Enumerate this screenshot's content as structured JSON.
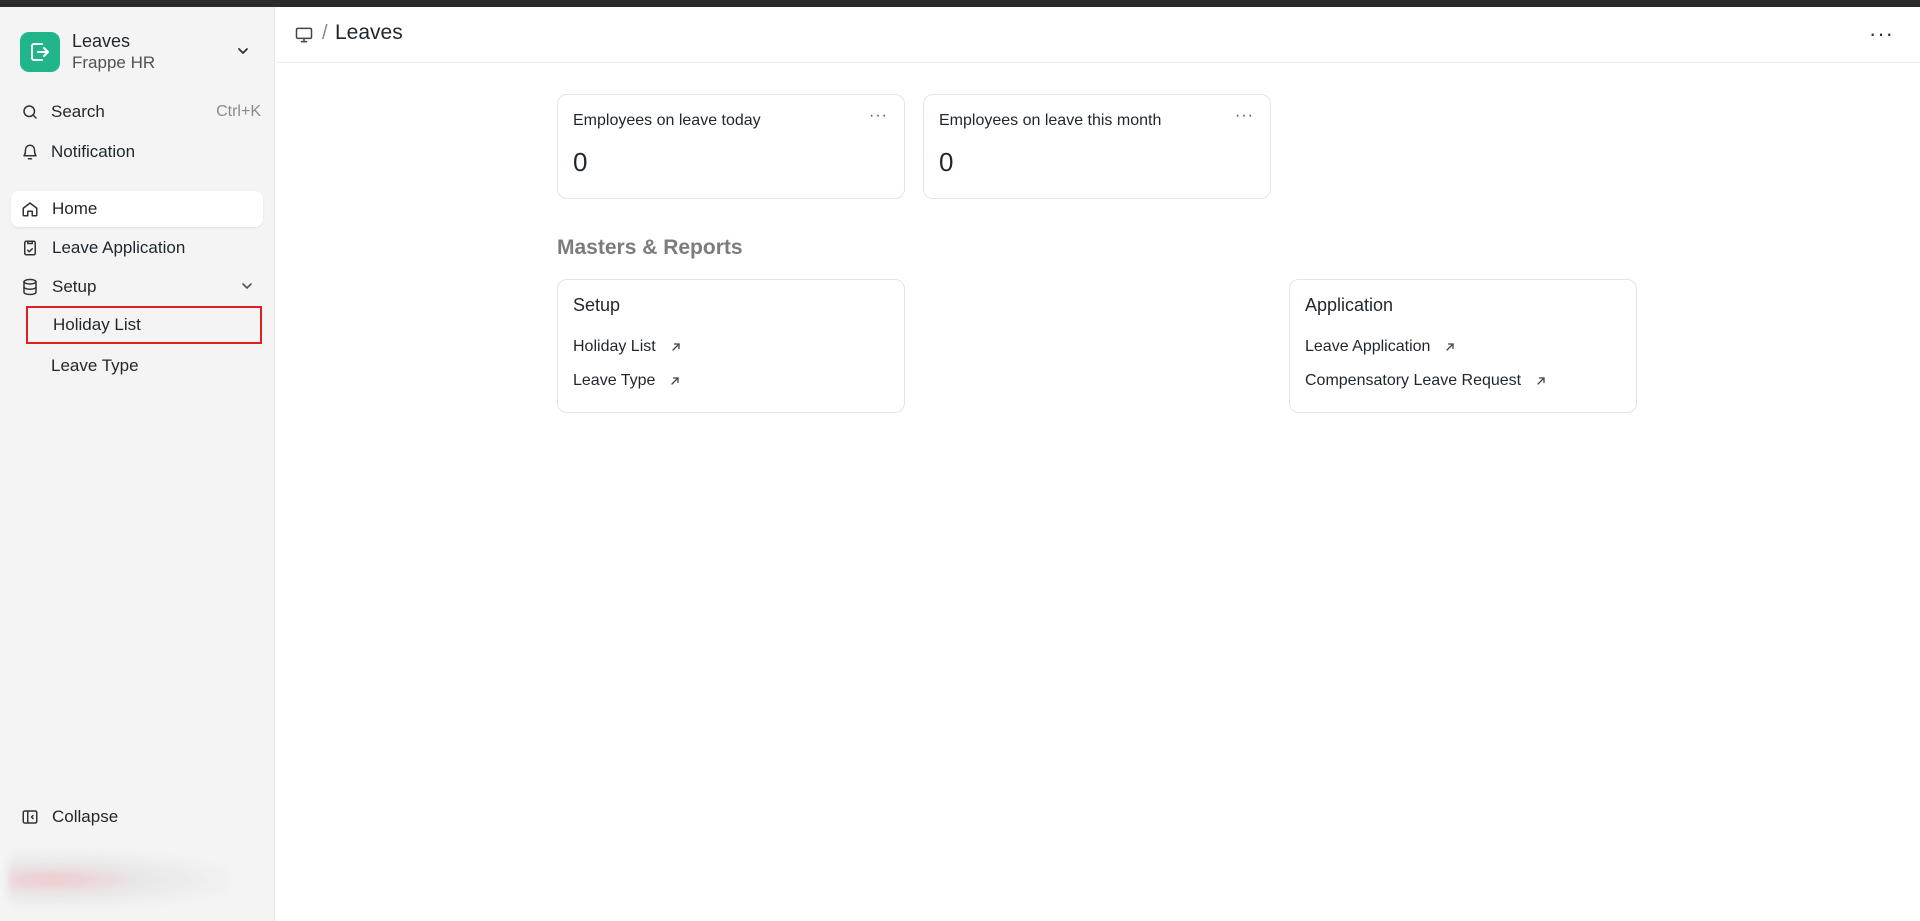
{
  "app": {
    "title": "Leaves",
    "subtitle": "Frappe HR"
  },
  "sidebar": {
    "search": {
      "label": "Search",
      "shortcut": "Ctrl+K"
    },
    "notification": {
      "label": "Notification"
    },
    "items": [
      {
        "label": "Home"
      },
      {
        "label": "Leave Application"
      },
      {
        "label": "Setup"
      }
    ],
    "setup_children": [
      {
        "label": "Holiday List"
      },
      {
        "label": "Leave Type"
      }
    ],
    "collapse": {
      "label": "Collapse"
    }
  },
  "header": {
    "breadcrumb_sep": "/",
    "title": "Leaves",
    "more": "···"
  },
  "number_cards": [
    {
      "title": "Employees on leave today",
      "value": "0",
      "menu": "···"
    },
    {
      "title": "Employees on leave this month",
      "value": "0",
      "menu": "···"
    }
  ],
  "section": {
    "title": "Masters & Reports"
  },
  "link_cards": [
    {
      "title": "Setup",
      "links": [
        {
          "label": "Holiday List"
        },
        {
          "label": "Leave Type"
        }
      ]
    },
    {
      "title": "Application",
      "links": [
        {
          "label": "Leave Application"
        },
        {
          "label": "Compensatory Leave Request"
        }
      ]
    }
  ],
  "colors": {
    "brand": "#21b68a",
    "highlight": "#e02020"
  },
  "icons": {
    "app_logo": "exit-icon",
    "search": "search-icon",
    "notification": "bell-icon",
    "home": "home-icon",
    "leave_application": "clipboard-icon",
    "setup": "database-icon",
    "collapse": "sidebar-collapse-icon",
    "breadcrumb": "monitor-icon",
    "link": "arrow-up-right-icon"
  }
}
